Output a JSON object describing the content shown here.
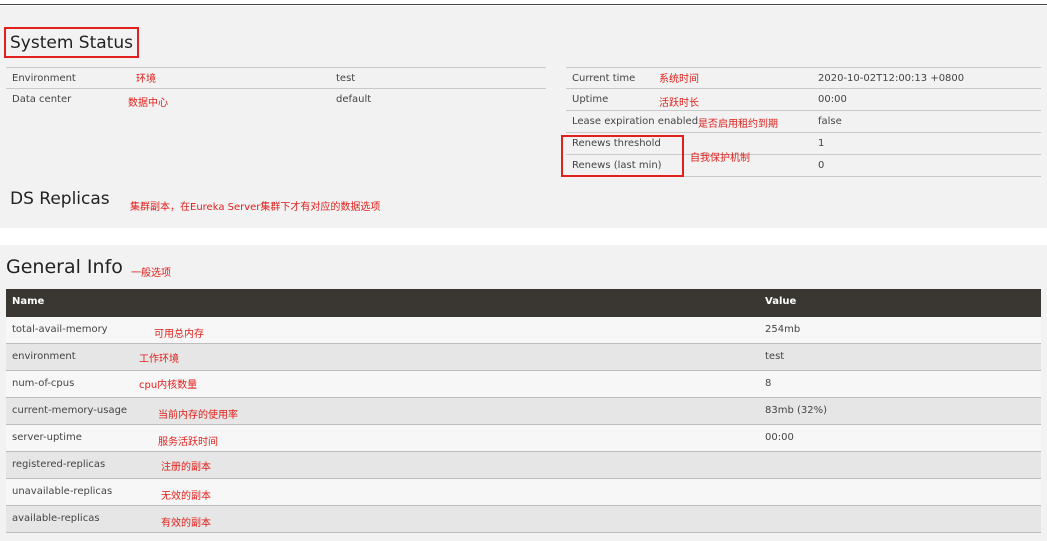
{
  "system_status": {
    "title": "System Status",
    "title_annotation": "",
    "left_rows": [
      {
        "label": "Environment",
        "annotation": "环境",
        "value": "test"
      },
      {
        "label": "Data center",
        "annotation": "数据中心",
        "value": "default"
      }
    ],
    "right_rows": [
      {
        "label": "Current time",
        "annotation": "系统时间",
        "value": "2020-10-02T12:00:13 +0800"
      },
      {
        "label": "Uptime",
        "annotation": "活跃时长",
        "value": "00:00"
      },
      {
        "label": "Lease expiration enabled",
        "annotation": "是否启用租约到期",
        "value": "false"
      },
      {
        "label": "Renews threshold",
        "annotation": "",
        "value": "1"
      },
      {
        "label": "Renews (last min)",
        "annotation": "",
        "value": "0"
      }
    ],
    "self_protection_annotation": "自我保护机制"
  },
  "ds_replicas": {
    "title": "DS Replicas",
    "annotation": "集群副本，在Eureka Server集群下才有对应的数据选项"
  },
  "general_info": {
    "title": "General Info",
    "annotation": "一般选项",
    "columns": [
      "Name",
      "Value"
    ],
    "rows": [
      {
        "name": "total-avail-memory",
        "annotation": "可用总内存",
        "value": "254mb"
      },
      {
        "name": "environment",
        "annotation": "工作环境",
        "value": "test"
      },
      {
        "name": "num-of-cpus",
        "annotation": "cpu内核数量",
        "value": "8"
      },
      {
        "name": "current-memory-usage",
        "annotation": "当前内存的使用率",
        "value": "83mb (32%)"
      },
      {
        "name": "server-uptime",
        "annotation": "服务活跃时间",
        "value": "00:00"
      },
      {
        "name": "registered-replicas",
        "annotation": "注册的副本",
        "value": ""
      },
      {
        "name": "unavailable-replicas",
        "annotation": "无效的副本",
        "value": ""
      },
      {
        "name": "available-replicas",
        "annotation": "有效的副本",
        "value": ""
      }
    ]
  },
  "colors": {
    "annotation_red": "#e0201c",
    "header_dark": "#3a3732",
    "panel_bg": "#f2f2f2"
  }
}
